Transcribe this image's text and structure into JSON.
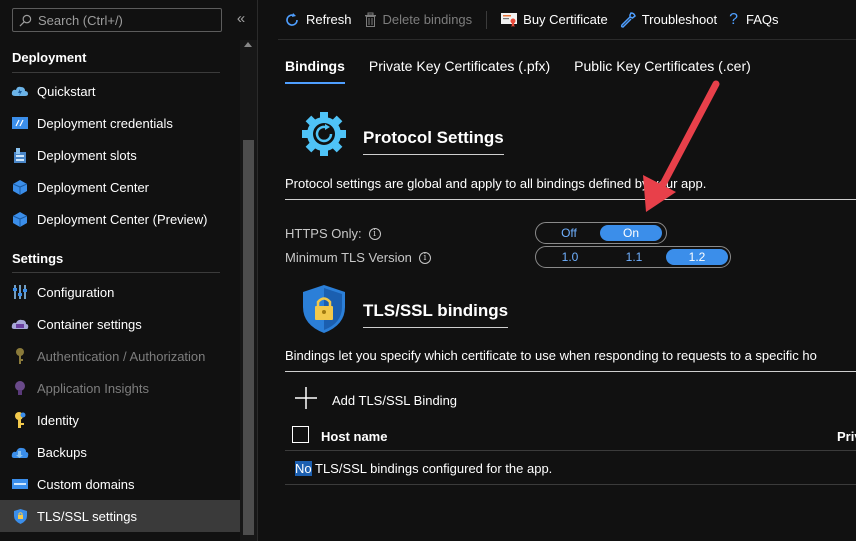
{
  "sidebar": {
    "search_placeholder": "Search (Ctrl+/)",
    "collapse_glyph": "«",
    "sections": [
      {
        "title": "Deployment"
      },
      {
        "title": "Settings"
      }
    ],
    "items": [
      {
        "label": "Quickstart",
        "icon": "cloud-lightning-icon"
      },
      {
        "label": "Deployment credentials",
        "icon": "credentials-icon"
      },
      {
        "label": "Deployment slots",
        "icon": "slots-icon"
      },
      {
        "label": "Deployment Center",
        "icon": "cube-icon"
      },
      {
        "label": "Deployment Center (Preview)",
        "icon": "cube-icon"
      },
      {
        "label": "Configuration",
        "icon": "sliders-icon"
      },
      {
        "label": "Container settings",
        "icon": "container-icon"
      },
      {
        "label": "Authentication / Authorization",
        "icon": "key-icon",
        "disabled": true
      },
      {
        "label": "Application Insights",
        "icon": "lightbulb-icon",
        "disabled": true
      },
      {
        "label": "Identity",
        "icon": "identity-icon"
      },
      {
        "label": "Backups",
        "icon": "cloud-backup-icon"
      },
      {
        "label": "Custom domains",
        "icon": "domain-icon"
      },
      {
        "label": "TLS/SSL settings",
        "icon": "shield-icon",
        "active": true
      }
    ]
  },
  "toolbar": {
    "refresh": "Refresh",
    "delete_bindings": "Delete bindings",
    "buy_certificate": "Buy Certificate",
    "troubleshoot": "Troubleshoot",
    "faqs": "FAQs"
  },
  "tabs": [
    {
      "label": "Bindings",
      "active": true
    },
    {
      "label": "Private Key Certificates (.pfx)"
    },
    {
      "label": "Public Key Certificates (.cer)"
    }
  ],
  "protocol": {
    "title": "Protocol Settings",
    "description": "Protocol settings are global and apply to all bindings defined by your app.",
    "https_only_label": "HTTPS Only:",
    "https_only_options": [
      "Off",
      "On"
    ],
    "https_only_selected": "On",
    "tls_label": "Minimum TLS Version",
    "tls_options": [
      "1.0",
      "1.1",
      "1.2"
    ],
    "tls_selected": "1.2"
  },
  "bindings": {
    "title": "TLS/SSL bindings",
    "description": "Bindings let you specify which certificate to use when responding to requests to a specific ho",
    "add_label": "Add TLS/SSL Binding",
    "columns": [
      "Host name",
      "Priv"
    ],
    "empty_highlight": "No",
    "empty_rest": " TLS/SSL bindings configured for the app."
  },
  "colors": {
    "accent": "#3b8eea",
    "annotation_arrow": "#e8404a",
    "background": "#111111"
  }
}
